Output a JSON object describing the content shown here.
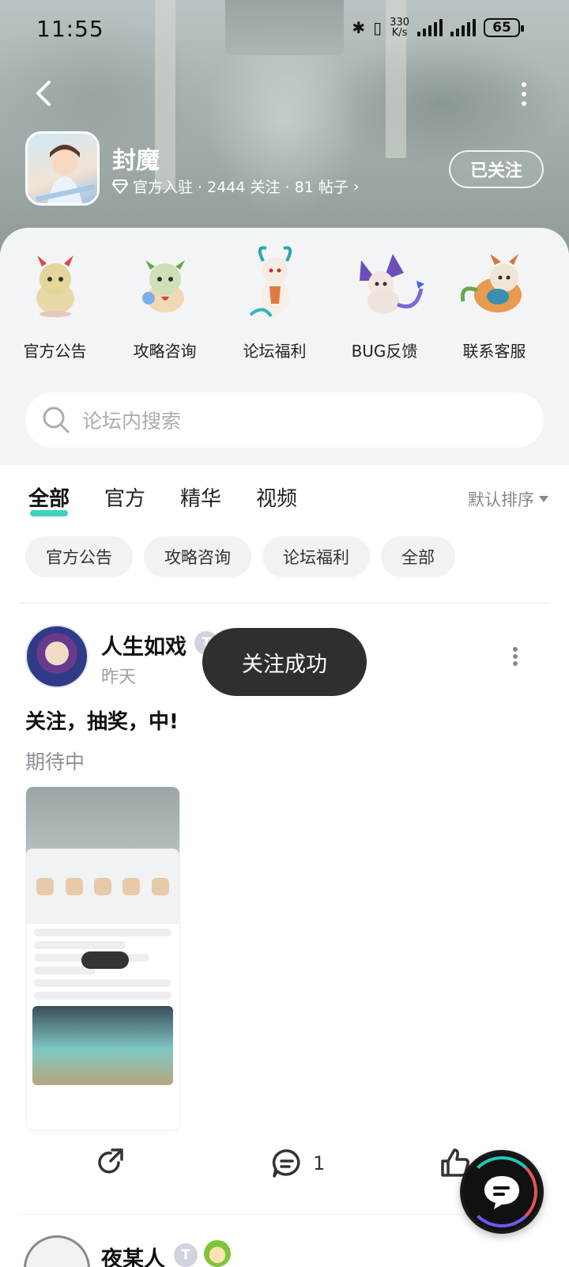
{
  "status_bar": {
    "time": "11:55",
    "net_speed_value": "330",
    "net_speed_unit": "K/s",
    "battery": "65"
  },
  "header": {
    "game_title": "封魔",
    "meta_text": "官方入驻 · 2444 关注 · 81 帖子",
    "follow_label": "已关注"
  },
  "categories": [
    {
      "label": "官方公告"
    },
    {
      "label": "攻略咨询"
    },
    {
      "label": "论坛福利"
    },
    {
      "label": "BUG反馈"
    },
    {
      "label": "联系客服"
    }
  ],
  "search": {
    "placeholder": "论坛内搜索"
  },
  "tabs": [
    {
      "label": "全部",
      "active": true
    },
    {
      "label": "官方"
    },
    {
      "label": "精华"
    },
    {
      "label": "视频"
    }
  ],
  "sort_label": "默认排序",
  "chips": [
    "官方公告",
    "攻略咨询",
    "论坛福利",
    "全部"
  ],
  "post": {
    "author": "人生如戏",
    "author_badge": "T",
    "time": "昨天",
    "title": "关注，抽奖，中!",
    "body": "期待中",
    "share_count": "",
    "comment_count": "1"
  },
  "next_post": {
    "author": "夜某人",
    "author_badge": "T"
  },
  "toast": "关注成功",
  "colors": {
    "accent": "#1fc8b8",
    "toast_bg": "#2f2f2f"
  }
}
